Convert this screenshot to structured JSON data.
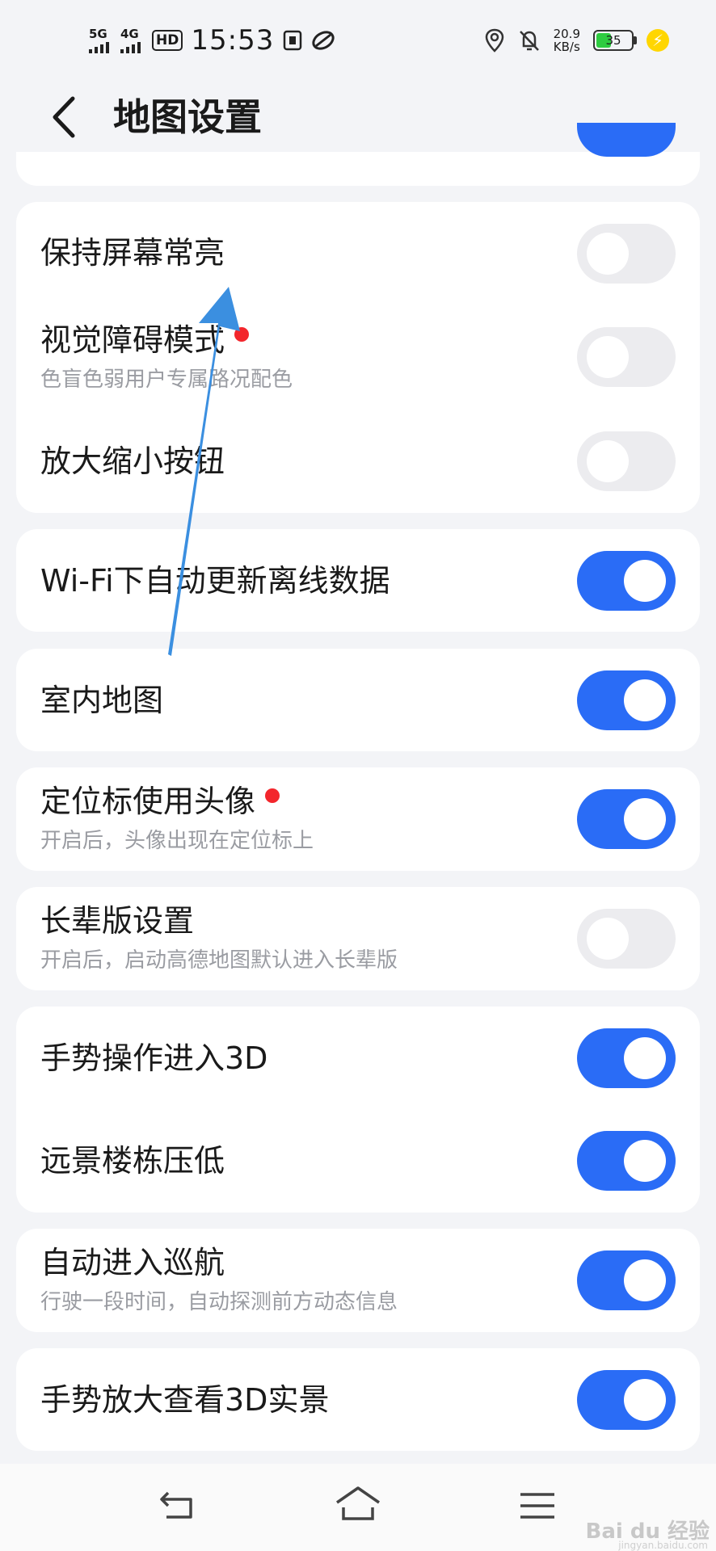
{
  "status_bar": {
    "signal1": "5G",
    "signal2": "4G",
    "hd_label": "HD",
    "time": "15:53",
    "net_speed_value": "20.9",
    "net_speed_unit": "KB/s",
    "battery": "35"
  },
  "header": {
    "title": "地图设置"
  },
  "settings": [
    {
      "label": "保持屏幕常亮",
      "toggle": "off"
    },
    {
      "label": "视觉障碍模式",
      "sub": "色盲色弱用户专属路况配色",
      "toggle": "off",
      "badge": true
    },
    {
      "label": "放大缩小按钮",
      "toggle": "off"
    },
    {
      "label": "Wi-Fi下自动更新离线数据",
      "toggle": "on"
    },
    {
      "label": "室内地图",
      "toggle": "on"
    },
    {
      "label": "定位标使用头像",
      "sub": "开启后，头像出现在定位标上",
      "toggle": "on",
      "badge": true
    },
    {
      "label": "长辈版设置",
      "sub": "开启后，启动高德地图默认进入长辈版",
      "toggle": "off"
    },
    {
      "label": "手势操作进入3D",
      "toggle": "on"
    },
    {
      "label": "远景楼栋压低",
      "toggle": "on"
    },
    {
      "label": "自动进入巡航",
      "sub": "行驶一段时间，自动探测前方动态信息",
      "toggle": "on"
    },
    {
      "label": "手势放大查看3D实景",
      "toggle": "on"
    }
  ],
  "watermark": {
    "brand": "Bai du 经验",
    "url": "jingyan.baidu.com"
  },
  "colors": {
    "accent": "#2a6cf6",
    "toggle_off": "#ececef",
    "badge": "#f3262c",
    "background": "#f3f4f7",
    "annotation_arrow": "#3b8fe0"
  },
  "annotation": {
    "type": "arrow",
    "direction": "up",
    "target": "保持屏幕常亮"
  }
}
